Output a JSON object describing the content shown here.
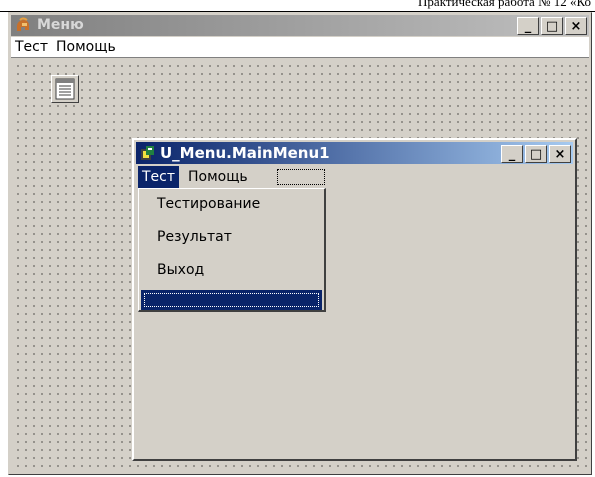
{
  "page": {
    "header_text": "Практическая работа № 12 «Ко"
  },
  "outer_window": {
    "title": "Меню",
    "title_icon": "app-helmet-icon",
    "caption_buttons": [
      "_",
      "□",
      "×"
    ],
    "menu": [
      "Тест",
      "Помощь"
    ]
  },
  "components": {
    "mainmenu_icon": "mainmenu-component-icon"
  },
  "menu_designer": {
    "title": "U_Menu.MainMenu1",
    "title_icon": "menu-designer-icon",
    "caption_buttons": [
      "_",
      "□",
      "×"
    ],
    "menu": [
      "Тест",
      "Помощь"
    ],
    "active_menu": "Тест",
    "dropdown_items": [
      "Тестирование",
      "Результат",
      "Выход"
    ]
  },
  "colors": {
    "window_bg": "#d4d0c8",
    "active_title_start": "#0a246a",
    "active_title_end": "#a6caf0",
    "inactive_title_start": "#808080",
    "highlight": "#0a246a"
  }
}
